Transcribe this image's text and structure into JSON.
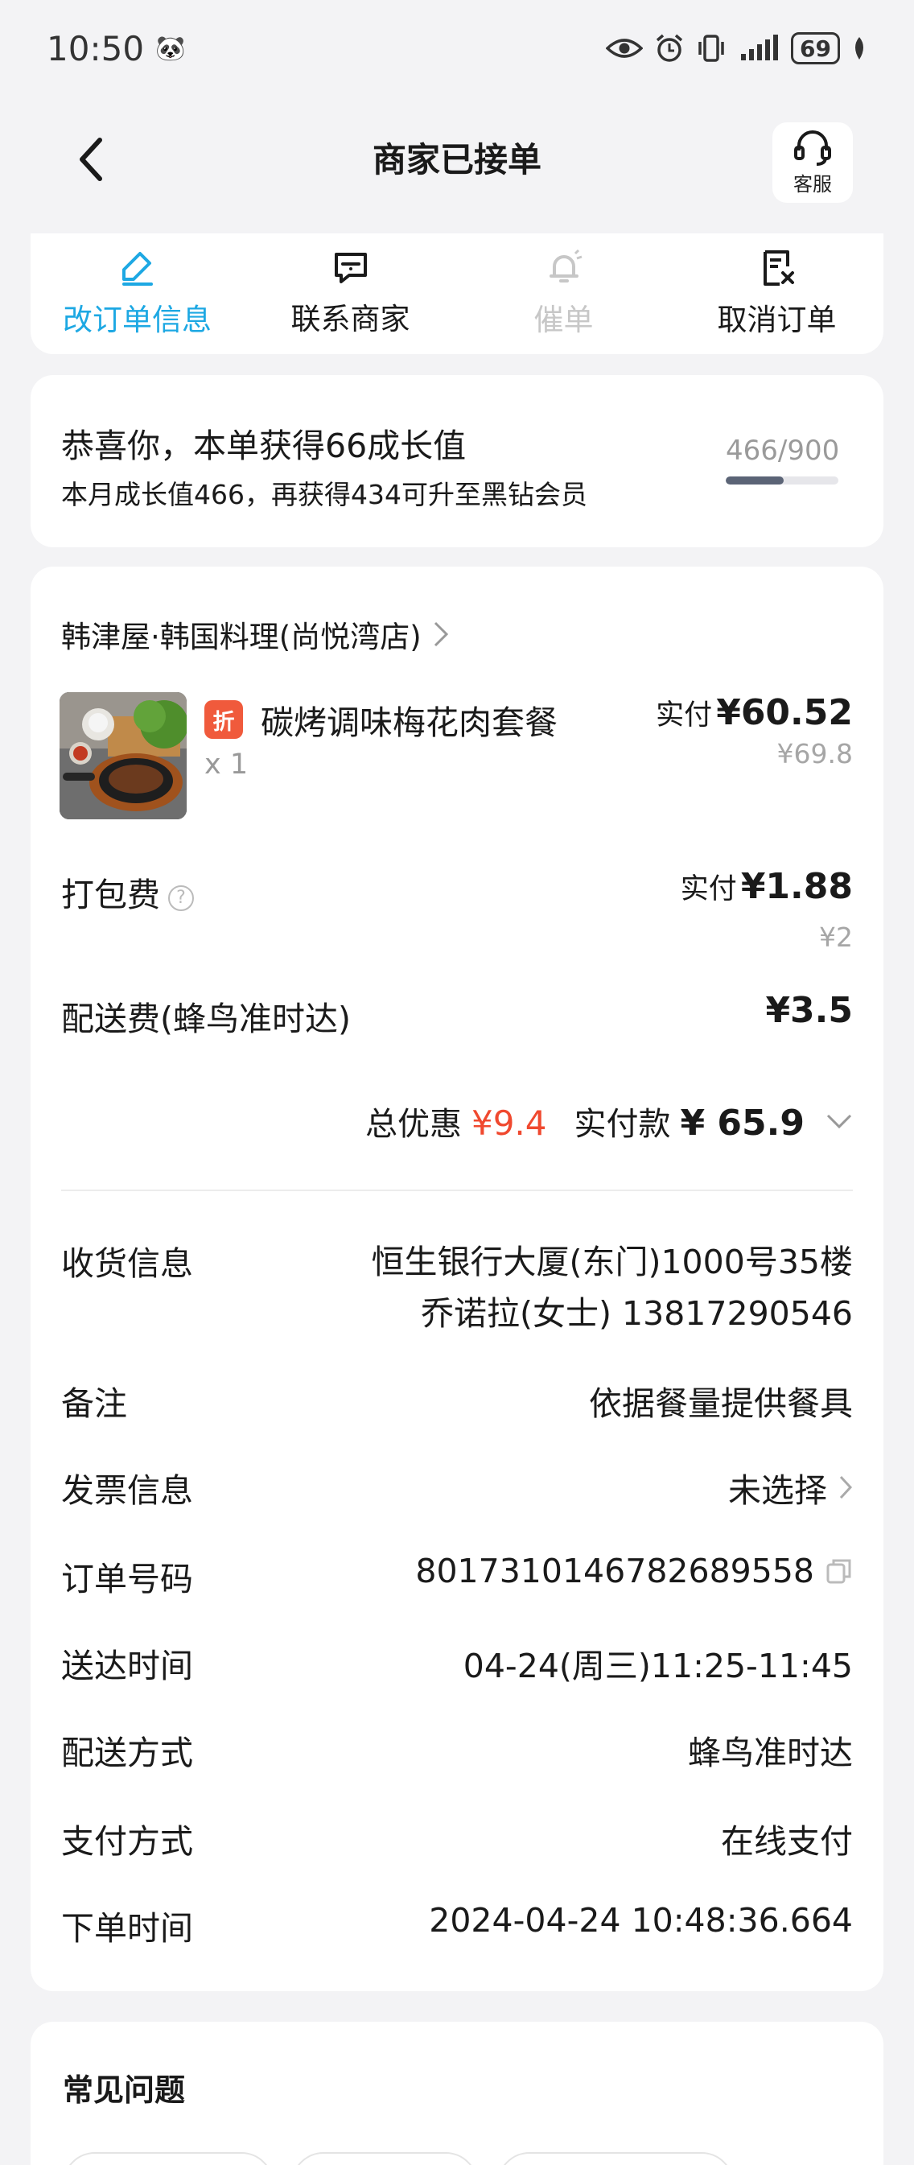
{
  "status_bar": {
    "time": "10:50",
    "battery": "69"
  },
  "header": {
    "title": "商家已接单",
    "service_label": "客服"
  },
  "actions": [
    {
      "label": "改订单信息",
      "state": "active",
      "icon": "edit-icon"
    },
    {
      "label": "联系商家",
      "state": "normal",
      "icon": "chat-icon"
    },
    {
      "label": "催单",
      "state": "disabled",
      "icon": "bell-icon"
    },
    {
      "label": "取消订单",
      "state": "normal",
      "icon": "cancel-doc-icon"
    }
  ],
  "growth": {
    "headline": "恭喜你，本单获得66成长值",
    "detail": "本月成长值466，再获得434可升至黑钻会员",
    "progress_text": "466/900",
    "progress_value": 466,
    "progress_max": 900
  },
  "order": {
    "shop_name": "韩津屋·韩国料理(尚悦湾店)",
    "item": {
      "tag": "折",
      "name": "碳烤调味梅花肉套餐",
      "qty": "x 1",
      "paid_label": "实付",
      "paid_price": "¥60.52",
      "original_price": "¥69.8"
    },
    "packing": {
      "label": "打包费",
      "paid_label": "实付",
      "paid_price": "¥1.88",
      "original_price": "¥2"
    },
    "delivery_fee": {
      "label": "配送费(蜂鸟准时达)",
      "price": "¥3.5"
    },
    "summary": {
      "discount_label": "总优惠",
      "discount_value": "¥9.4",
      "total_label": "实付款",
      "total_value": "¥ 65.9"
    },
    "details": {
      "address_label": "收货信息",
      "address_line1": "恒生银行大厦(东门)1000号35楼",
      "address_line2": "乔诺拉(女士) 13817290546",
      "remark_label": "备注",
      "remark_value": "依据餐量提供餐具",
      "invoice_label": "发票信息",
      "invoice_value": "未选择",
      "order_no_label": "订单号码",
      "order_no_value": "8017310146782689558",
      "delivery_time_label": "送达时间",
      "delivery_time_value": "04-24(周三)11:25-11:45",
      "delivery_method_label": "配送方式",
      "delivery_method_value": "蜂鸟准时达",
      "payment_label": "支付方式",
      "payment_value": "在线支付",
      "order_time_label": "下单时间",
      "order_time_value": "2024-04-24 10:48:36.664"
    }
  },
  "faq": {
    "title": "常见问题"
  },
  "colors": {
    "accent": "#1da8e3",
    "discount_red": "#f0492f",
    "tag_red": "#f05a3c"
  }
}
